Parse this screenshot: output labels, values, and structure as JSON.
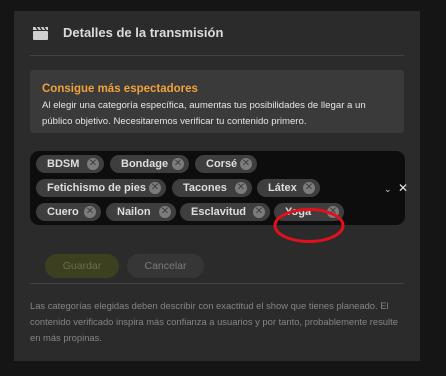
{
  "header": {
    "icon": "clapperboard-icon",
    "title": "Detalles de la transmisión"
  },
  "promo": {
    "title": "Consigue más espectadores",
    "text": "Al elegir una categoría específica, aumentas tus posibilidades de llegar a un público objetivo. Necesitaremos verificar tu contenido primero."
  },
  "tags": [
    "BDSM",
    "Bondage",
    "Corsé",
    "Fetichismo de pies",
    "Tacones",
    "Látex",
    "Cuero",
    "Nailon",
    "Esclavitud",
    "Yoga"
  ],
  "tag_remove_icon": "circle-x-icon",
  "controls": {
    "chevron": "⌄",
    "clear": "✕"
  },
  "buttons": {
    "save": "Guardar",
    "cancel": "Cancelar"
  },
  "footer": {
    "text": "Las categorías elegidas deben describir con exactitud el show que tienes planeado. El contenido verificado inspira más confianza a usuarios y por tanto, probablemente resulte en más propinas."
  },
  "colors": {
    "accent": "#f0a23a",
    "annotation_circle": "#e3101c",
    "panel_bg": "#2b2b2b",
    "tag_bg": "#3e3e3e"
  }
}
